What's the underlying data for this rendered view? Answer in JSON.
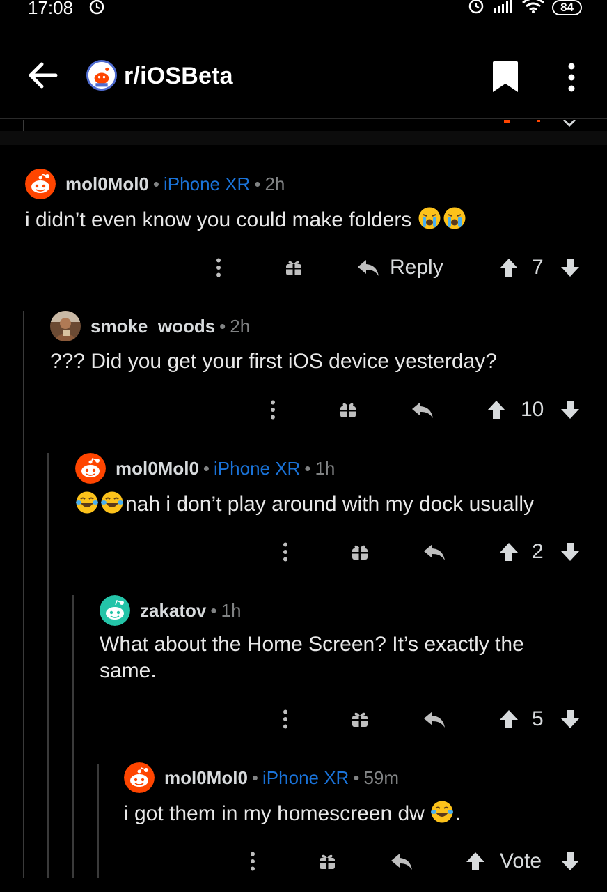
{
  "status_bar": {
    "time": "17:08",
    "battery": "84"
  },
  "header": {
    "subreddit": "r/iOSBeta"
  },
  "comments": [
    {
      "author": "mol0Mol0",
      "flair": "iPhone XR",
      "time": "2h",
      "body": "i didn’t even know you could make folders",
      "reply_label": "Reply",
      "score": "7"
    },
    {
      "author": "smoke_woods",
      "time": "2h",
      "body": "??? Did you get your first iOS device yesterday?",
      "score": "10"
    },
    {
      "author": "mol0Mol0",
      "flair": "iPhone XR",
      "time": "1h",
      "body": "nah i don’t play around with my dock usually",
      "score": "2"
    },
    {
      "author": "zakatov",
      "time": "1h",
      "body_lines": [
        "What about the Home Screen? It’s exactly the",
        "same."
      ],
      "score": "5"
    },
    {
      "author": "mol0Mol0",
      "flair": "iPhone XR",
      "time": "59m",
      "body": "i got them in my homescreen dw",
      "body_suffix": ".",
      "score": "Vote"
    }
  ],
  "colors": {
    "background": "#000000",
    "flair": "#1a73d9",
    "text": "#d7dadc",
    "meta": "#818384"
  },
  "icons": [
    "arrow-left-icon",
    "bookmark-icon",
    "more-vertical-icon",
    "gift-icon",
    "reply-icon",
    "upvote-icon",
    "downvote-icon",
    "alarm-icon",
    "signal-icon",
    "wifi-icon",
    "battery-icon",
    "loudly-crying-emoji",
    "tears-of-joy-emoji"
  ]
}
